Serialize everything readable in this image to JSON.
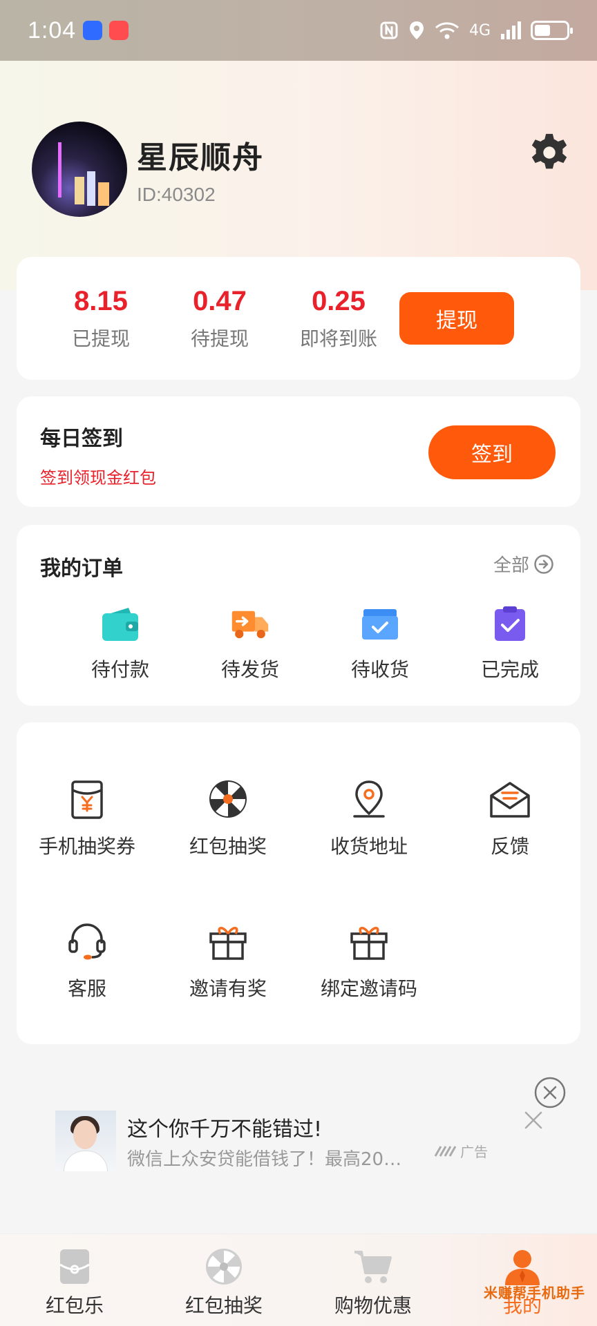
{
  "status_bar": {
    "time": "1:04",
    "network": "4G"
  },
  "profile": {
    "username": "星辰顺舟",
    "user_id": "ID:40302"
  },
  "balance": {
    "items": [
      {
        "value": "8.15",
        "label": "已提现"
      },
      {
        "value": "0.47",
        "label": "待提现"
      },
      {
        "value": "0.25",
        "label": "即将到账"
      }
    ],
    "withdraw_label": "提现"
  },
  "checkin": {
    "title": "每日签到",
    "subtitle": "签到领现金红包",
    "button_label": "签到"
  },
  "orders": {
    "title": "我的订单",
    "all_label": "全部",
    "items": [
      {
        "label": "待付款",
        "icon": "wallet-icon"
      },
      {
        "label": "待发货",
        "icon": "truck-icon"
      },
      {
        "label": "待收货",
        "icon": "box-icon"
      },
      {
        "label": "已完成",
        "icon": "clipboard-check-icon"
      }
    ]
  },
  "tools": {
    "items": [
      {
        "label": "手机抽奖券",
        "icon": "lottery-ticket-icon"
      },
      {
        "label": "红包抽奖",
        "icon": "lucky-wheel-icon"
      },
      {
        "label": "收货地址",
        "icon": "location-pin-icon"
      },
      {
        "label": "反馈",
        "icon": "envelope-icon"
      },
      {
        "label": "客服",
        "icon": "headset-icon"
      },
      {
        "label": "邀请有奖",
        "icon": "gift-icon"
      },
      {
        "label": "绑定邀请码",
        "icon": "gift-icon"
      }
    ]
  },
  "ad": {
    "title": "这个你千万不能错过!",
    "subtitle": "微信上众安贷能借钱了！最高20…",
    "badge": "广告"
  },
  "bottom_nav": {
    "items": [
      {
        "label": "红包乐",
        "icon": "red-packet-icon"
      },
      {
        "label": "红包抽奖",
        "icon": "wheel-icon"
      },
      {
        "label": "购物优惠",
        "icon": "cart-icon"
      },
      {
        "label": "我的",
        "icon": "user-icon"
      }
    ]
  },
  "watermark": "米赚帮手机助手",
  "colors": {
    "accent": "#ff5a0c",
    "money_red": "#e8212b",
    "icon_orange": "#f56d1f"
  }
}
